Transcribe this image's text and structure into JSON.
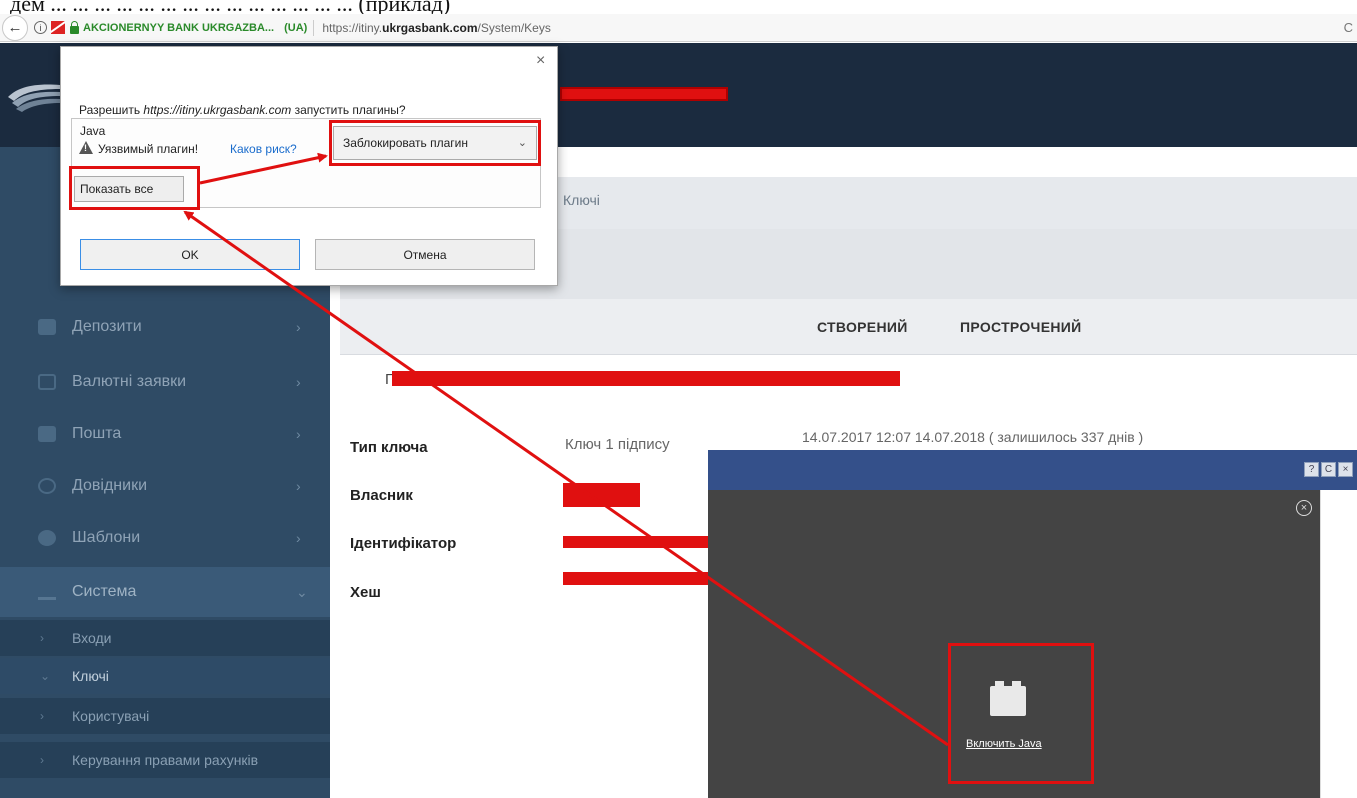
{
  "doc_fragment": "дем ... ... ... ... ... ... ... ... ... ... ... ... ... ... (приклад)",
  "browser": {
    "site_identity": "AKCIONERNYY BANK UKRGAZBA...",
    "site_country": "(UA)",
    "url_prefix": "https://itiny.",
    "url_domain": "ukrgasbank.com",
    "url_path": "/System/Keys",
    "url_end_glyph": "C"
  },
  "plugin_popup": {
    "question_prefix": "Разрешить ",
    "question_site": "https://itiny.ukrgasbank.com",
    "question_suffix": " запустить плагины?",
    "close_glyph": "×",
    "plugin_name": "Java",
    "warning_text": "Уязвимый плагин!",
    "risk_link": "Каков риск?",
    "select_value": "Заблокировать плагин",
    "show_all": "Показать все",
    "ok": "OK",
    "cancel": "Отмена"
  },
  "sidebar": {
    "items": [
      {
        "label": "Депозити",
        "icon": "deposit-icon"
      },
      {
        "label": "Валютні заявки",
        "icon": "currency-request-icon"
      },
      {
        "label": "Пошта",
        "icon": "mail-icon"
      },
      {
        "label": "Довідники",
        "icon": "info-icon"
      },
      {
        "label": "Шаблони",
        "icon": "templates-icon"
      },
      {
        "label": "Система",
        "icon": "system-icon"
      }
    ],
    "sub_items": [
      {
        "label": "Входи"
      },
      {
        "label": "Ключі"
      },
      {
        "label": "Користувачі"
      },
      {
        "label": "Керування правами рахунків"
      }
    ]
  },
  "main": {
    "breadcrumb": "Ключі",
    "tabs": [
      "СТВОРЕНИЙ",
      "ПРОСТРОЧЕНИЙ"
    ],
    "row_prefix": "Г",
    "fields": [
      {
        "label": "Тип ключа",
        "value": "Ключ 1 підпису"
      },
      {
        "label": "Власник",
        "value": ""
      },
      {
        "label": "Ідентифікатор",
        "value": ""
      },
      {
        "label": "Хеш",
        "value": ""
      }
    ],
    "dates": "14.07.2017 12:07  14.07.2018 ( залишилось 337 днів )"
  },
  "java_panel": {
    "enable_java": "Включить Java",
    "title_buttons": [
      "?",
      "C",
      "×"
    ]
  },
  "colors": {
    "header_bg": "#1b2b3f",
    "sidebar_bg": "#2f4b65",
    "annotation_red": "#e01010",
    "java_titlebar": "#34508a"
  }
}
